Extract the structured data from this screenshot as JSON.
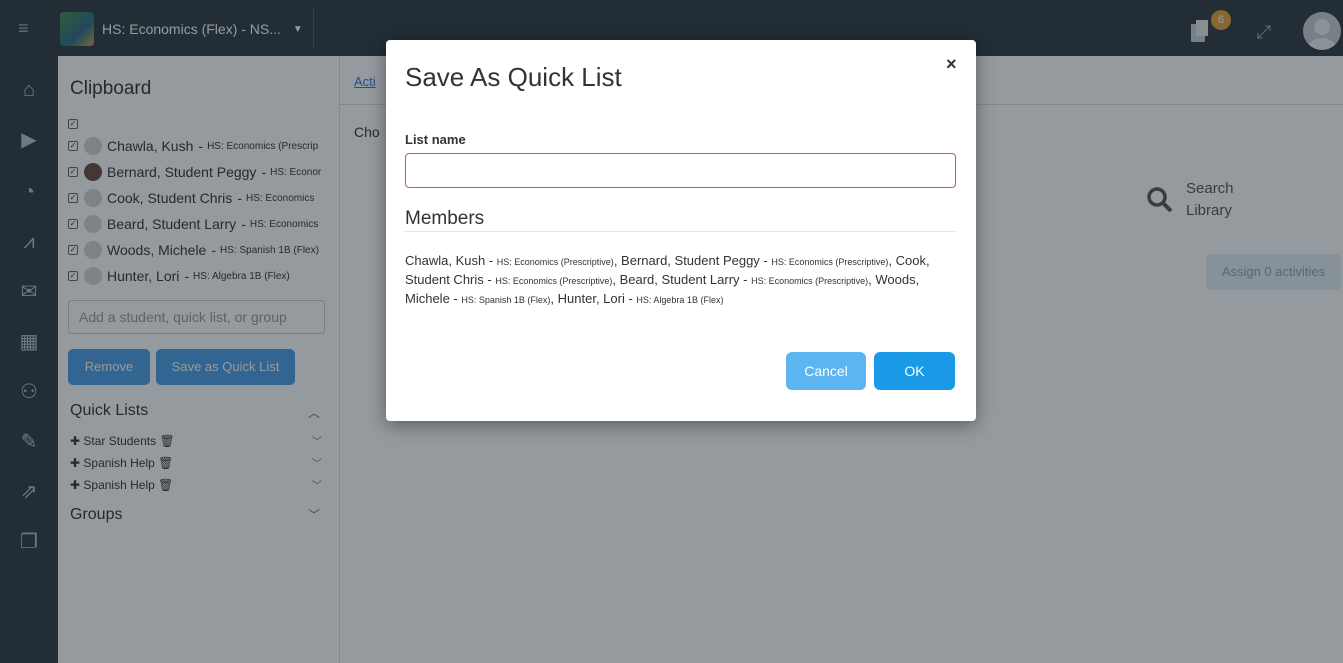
{
  "topbar": {
    "course_name": "HS: Economics (Flex) - NS...",
    "notification_count": "6"
  },
  "clipboard": {
    "title": "Clipboard",
    "students": [
      {
        "name": "Chawla, Kush",
        "course": "HS: Economics (Prescrip"
      },
      {
        "name": "Bernard, Student Peggy",
        "course": "HS: Econor"
      },
      {
        "name": "Cook, Student Chris",
        "course": "HS: Economics"
      },
      {
        "name": "Beard, Student Larry",
        "course": "HS: Economics"
      },
      {
        "name": "Woods, Michele",
        "course": "HS: Spanish 1B (Flex)"
      },
      {
        "name": "Hunter, Lori",
        "course": "HS: Algebra 1B (Flex)"
      }
    ],
    "add_placeholder": "Add a student, quick list, or group",
    "remove_label": "Remove",
    "save_quick_list_label": "Save as Quick List",
    "quick_lists_label": "Quick Lists",
    "quick_lists": [
      "Star Students",
      "Spanish Help",
      "Spanish Help"
    ],
    "groups_label": "Groups"
  },
  "main": {
    "tab_label": "Acti",
    "choose_text": "Cho",
    "search_library": "Search Library",
    "assign_label": "Assign 0 activities"
  },
  "modal": {
    "title": "Save As Quick List",
    "close": "×",
    "list_name_label": "List name",
    "list_name_value": "",
    "members_heading": "Members",
    "members": [
      {
        "name": "Chawla, Kush",
        "course": "HS: Economics (Prescriptive)"
      },
      {
        "name": "Bernard, Student Peggy",
        "course": "HS: Economics (Prescriptive)"
      },
      {
        "name": "Cook, Student Chris",
        "course": "HS: Economics (Prescriptive)"
      },
      {
        "name": "Beard, Student Larry",
        "course": "HS: Economics (Prescriptive)"
      },
      {
        "name": "Woods, Michele",
        "course": "HS: Spanish 1B (Flex)"
      },
      {
        "name": "Hunter, Lori",
        "course": "HS: Algebra 1B (Flex)"
      }
    ],
    "cancel_label": "Cancel",
    "ok_label": "OK"
  }
}
